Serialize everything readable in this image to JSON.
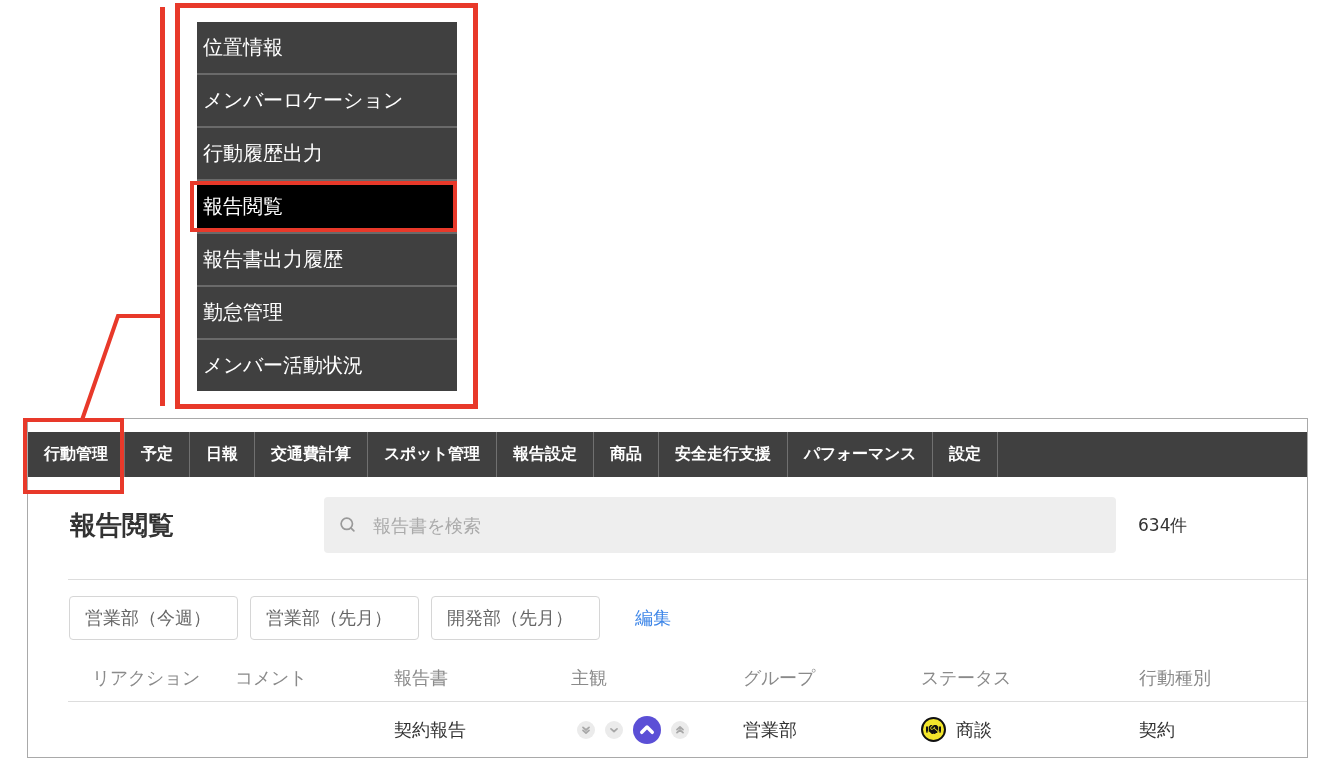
{
  "dropdown_menu": {
    "highlighted": true,
    "items": [
      {
        "label": "位置情報",
        "selected": false,
        "highlighted": false
      },
      {
        "label": "メンバーロケーション",
        "selected": false,
        "highlighted": false
      },
      {
        "label": "行動履歴出力",
        "selected": false,
        "highlighted": false
      },
      {
        "label": "報告閲覧",
        "selected": true,
        "highlighted": true
      },
      {
        "label": "報告書出力履歴",
        "selected": false,
        "highlighted": false
      },
      {
        "label": "勤怠管理",
        "selected": false,
        "highlighted": false
      },
      {
        "label": "メンバー活動状況",
        "selected": false,
        "highlighted": false
      }
    ]
  },
  "nav_tabs": [
    {
      "label": "行動管理",
      "highlighted": true
    },
    {
      "label": "予定",
      "highlighted": false
    },
    {
      "label": "日報",
      "highlighted": false
    },
    {
      "label": "交通費計算",
      "highlighted": false
    },
    {
      "label": "スポット管理",
      "highlighted": false
    },
    {
      "label": "報告設定",
      "highlighted": false
    },
    {
      "label": "商品",
      "highlighted": false
    },
    {
      "label": "安全走行支援",
      "highlighted": false
    },
    {
      "label": "パフォーマンス",
      "highlighted": false
    },
    {
      "label": "設定",
      "highlighted": false
    }
  ],
  "page_title": "報告閲覧",
  "search": {
    "placeholder": "報告書を検索"
  },
  "result_count": "634件",
  "saved_filters": [
    "営業部（今週）",
    "営業部（先月）",
    "開発部（先月）"
  ],
  "edit_link": "編集",
  "table": {
    "columns": [
      "リアクション",
      "コメント",
      "報告書",
      "主観",
      "グループ",
      "ステータス",
      "行動種別"
    ],
    "rows": [
      {
        "report": "契約報告",
        "sentiment": [
          {
            "kind": "very_negative",
            "selected": false
          },
          {
            "kind": "negative",
            "selected": false
          },
          {
            "kind": "positive",
            "selected": true
          },
          {
            "kind": "very_positive",
            "selected": false
          }
        ],
        "group": "営業部",
        "status": "商談",
        "action_type": "契約"
      }
    ]
  }
}
